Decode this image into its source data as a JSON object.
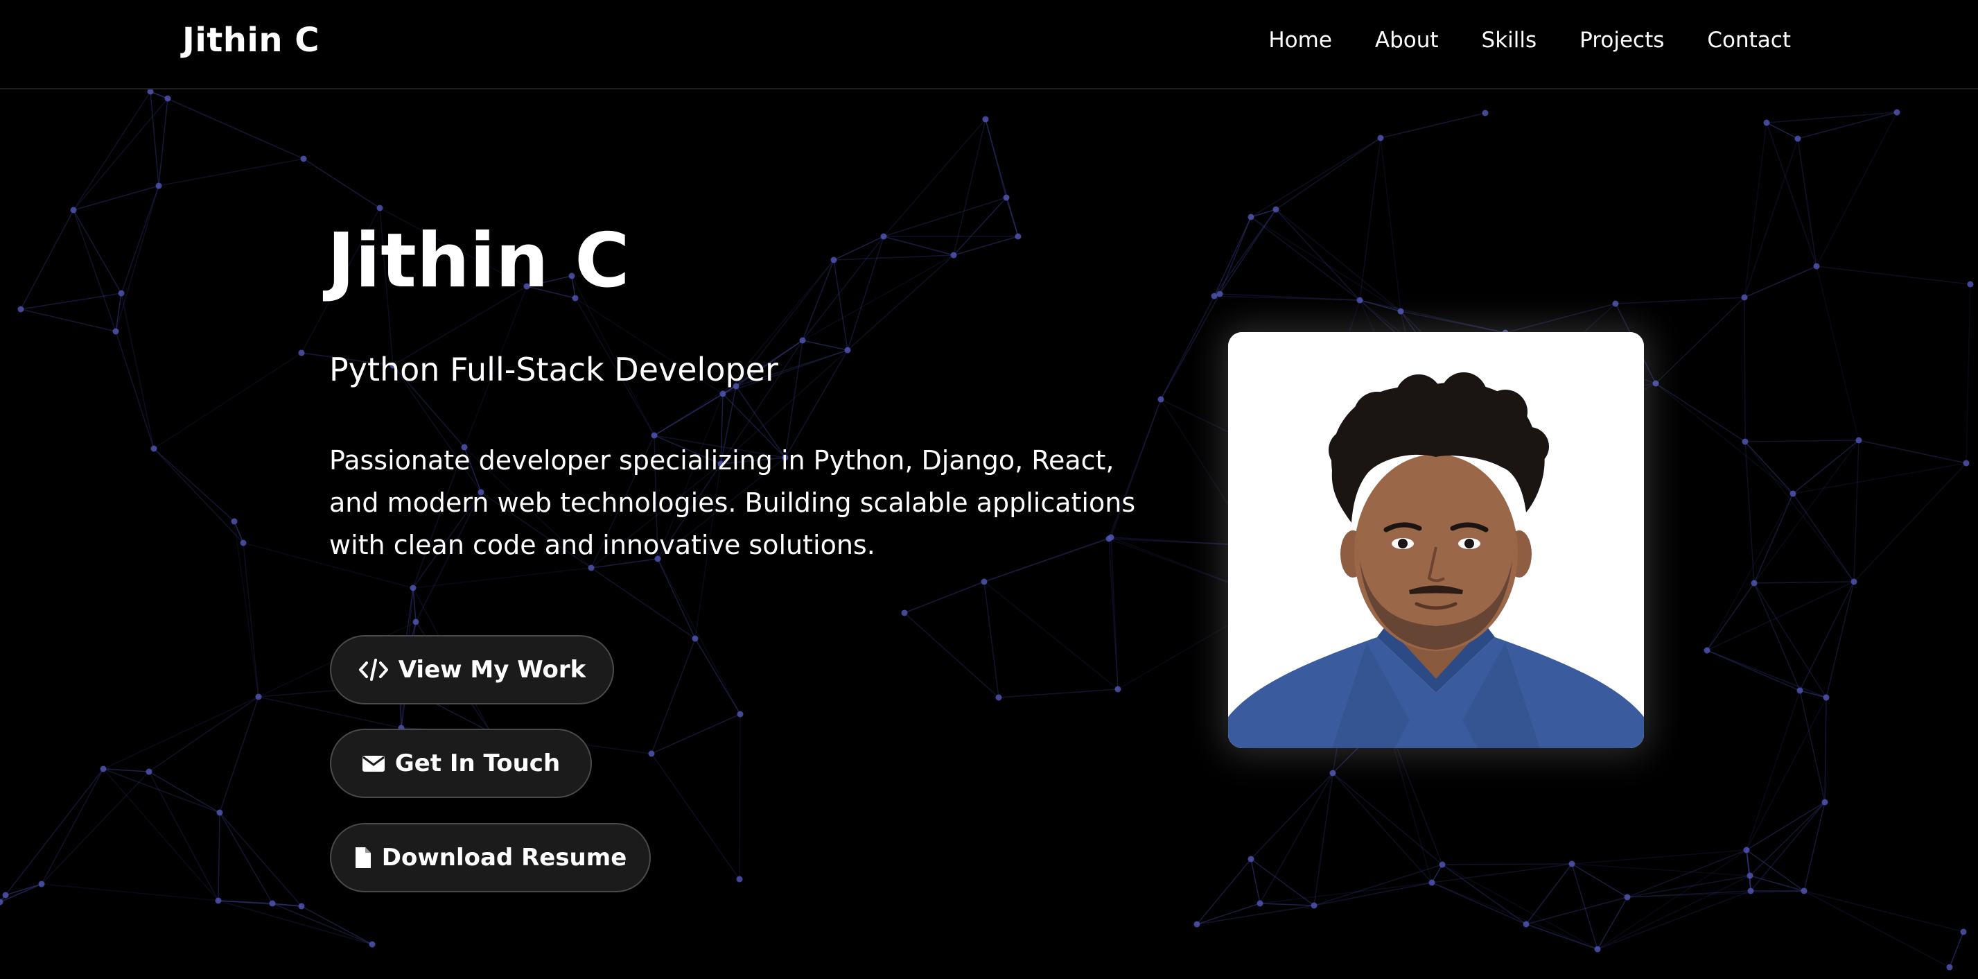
{
  "navbar": {
    "brand": "Jithin C",
    "links": [
      "Home",
      "About",
      "Skills",
      "Projects",
      "Contact"
    ]
  },
  "hero": {
    "name": "Jithin C",
    "role": "Python Full-Stack Developer",
    "description": "Passionate developer specializing in Python, Django, React, and modern web technologies. Building scalable applications with clean code and innovative solutions.",
    "buttons": {
      "view_work": "View My Work",
      "get_in_touch": "Get In Touch",
      "download_resume": "Download Resume"
    }
  },
  "icons": {
    "view_work": "code-icon",
    "get_in_touch": "envelope-icon",
    "download_resume": "file-icon"
  },
  "colors": {
    "background": "#000000",
    "network_line": "#3a3f8f",
    "network_node": "#4d55b0",
    "button_bg": "#1b1b1b",
    "button_border": "#4a4a4a",
    "text": "#ffffff"
  }
}
